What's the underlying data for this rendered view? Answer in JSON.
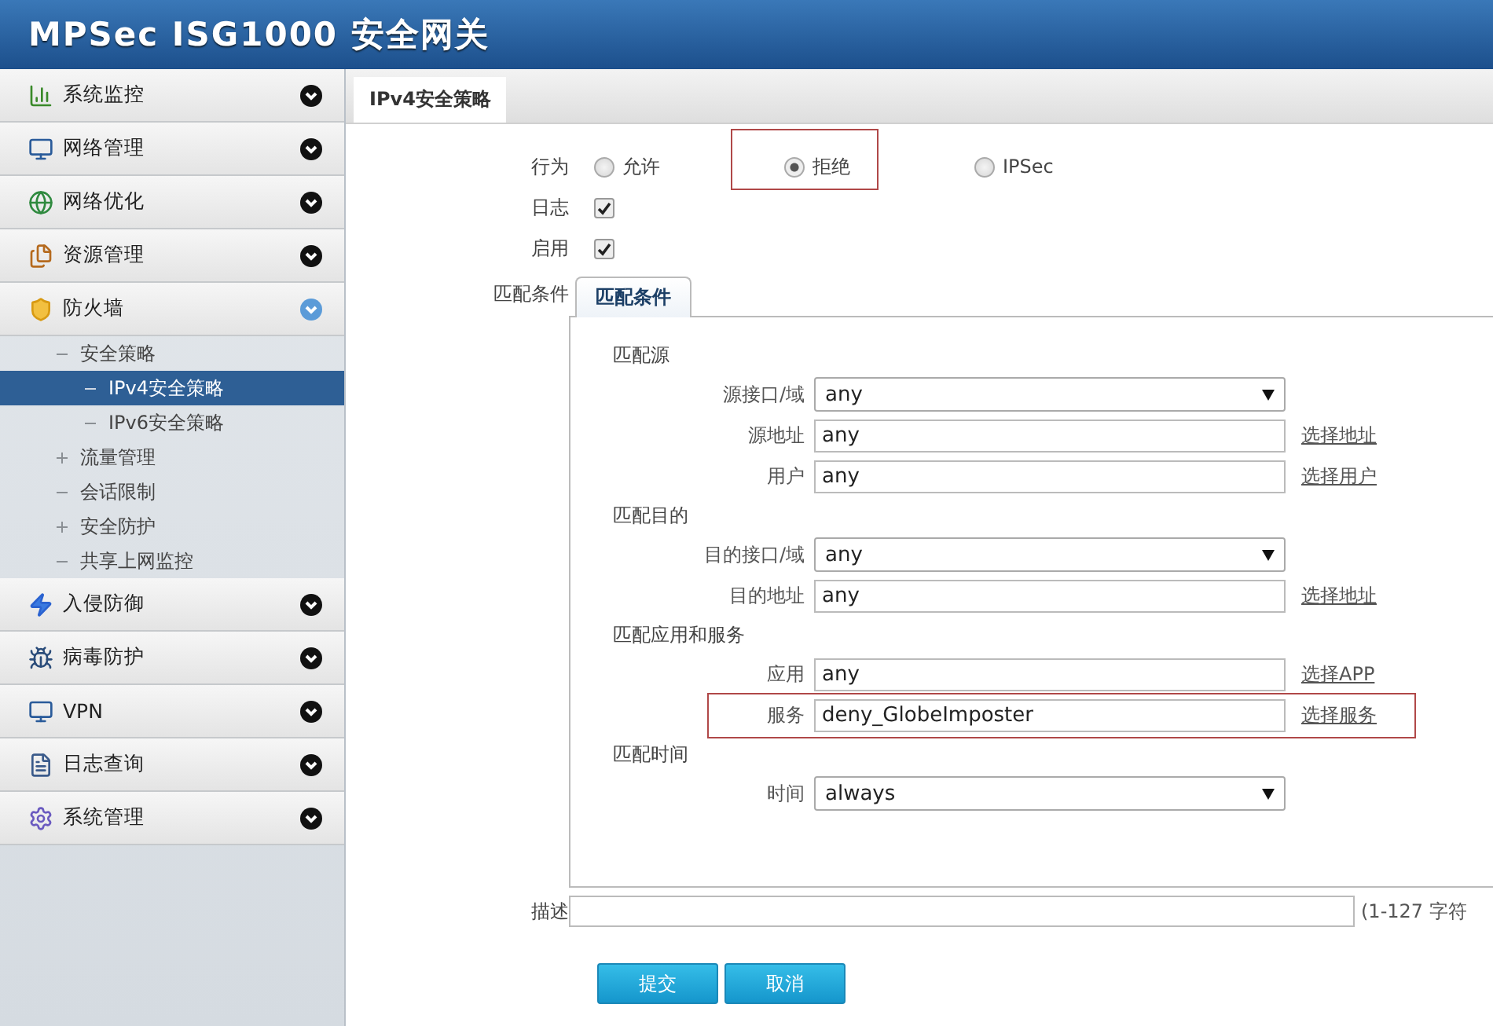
{
  "header": {
    "title": "MPSec ISG1000 安全网关"
  },
  "sidebar": {
    "items": [
      {
        "label": "系统监控",
        "expanded": false
      },
      {
        "label": "网络管理",
        "expanded": false
      },
      {
        "label": "网络优化",
        "expanded": false
      },
      {
        "label": "资源管理",
        "expanded": false
      },
      {
        "label": "防火墙",
        "expanded": true,
        "children": [
          {
            "label": "安全策略",
            "expanded": true,
            "selected": false,
            "children": [
              {
                "label": "IPv4安全策略",
                "expanded": true,
                "selected": true
              },
              {
                "label": "IPv6安全策略",
                "expanded": true,
                "selected": false
              }
            ]
          },
          {
            "label": "流量管理",
            "expanded": false,
            "selected": false
          },
          {
            "label": "会话限制",
            "expanded": true,
            "selected": false
          },
          {
            "label": "安全防护",
            "expanded": false,
            "selected": false
          },
          {
            "label": "共享上网监控",
            "expanded": true,
            "selected": false
          }
        ]
      },
      {
        "label": "入侵防御",
        "expanded": false
      },
      {
        "label": "病毒防护",
        "expanded": false
      },
      {
        "label": "VPN",
        "expanded": false
      },
      {
        "label": "日志查询",
        "expanded": false
      },
      {
        "label": "系统管理",
        "expanded": false
      }
    ]
  },
  "tabs": [
    {
      "label": "IPv4安全策略",
      "selected": true
    }
  ],
  "form": {
    "action": {
      "label": "行为",
      "options": [
        {
          "label": "允许",
          "selected": false,
          "highlighted": false
        },
        {
          "label": "拒绝",
          "selected": true,
          "highlighted": true
        },
        {
          "label": "IPSec",
          "selected": false,
          "highlighted": false
        }
      ]
    },
    "checks": [
      {
        "label": "日志",
        "checked": true
      },
      {
        "label": "启用",
        "checked": true
      }
    ],
    "match": {
      "label": "匹配条件",
      "tabs": [
        {
          "label": "匹配条件",
          "selected": true
        }
      ],
      "sections": [
        {
          "title": "匹配源",
          "fields": [
            {
              "kind": "select",
              "label": "源接口/域",
              "value": "any",
              "highlighted": false
            },
            {
              "kind": "text",
              "label": "源地址",
              "value": "any",
              "link": "选择地址",
              "highlighted": false
            },
            {
              "kind": "text",
              "label": "用户",
              "value": "any",
              "link": "选择用户",
              "highlighted": false
            }
          ]
        },
        {
          "title": "匹配目的",
          "fields": [
            {
              "kind": "select",
              "label": "目的接口/域",
              "value": "any",
              "highlighted": false
            },
            {
              "kind": "text",
              "label": "目的地址",
              "value": "any",
              "link": "选择地址",
              "highlighted": false
            }
          ]
        },
        {
          "title": "匹配应用和服务",
          "fields": [
            {
              "kind": "text",
              "label": "应用",
              "value": "any",
              "link": "选择APP",
              "highlighted": false
            },
            {
              "kind": "text",
              "label": "服务",
              "value": "deny_GlobeImposter",
              "link": "选择服务",
              "highlighted": true
            }
          ]
        },
        {
          "title": "匹配时间",
          "fields": [
            {
              "kind": "select",
              "label": "时间",
              "value": "always",
              "highlighted": false
            }
          ]
        }
      ]
    },
    "description": {
      "label": "描述",
      "hint": "(1-127 字符"
    },
    "buttons": [
      "提交",
      "取消"
    ]
  }
}
